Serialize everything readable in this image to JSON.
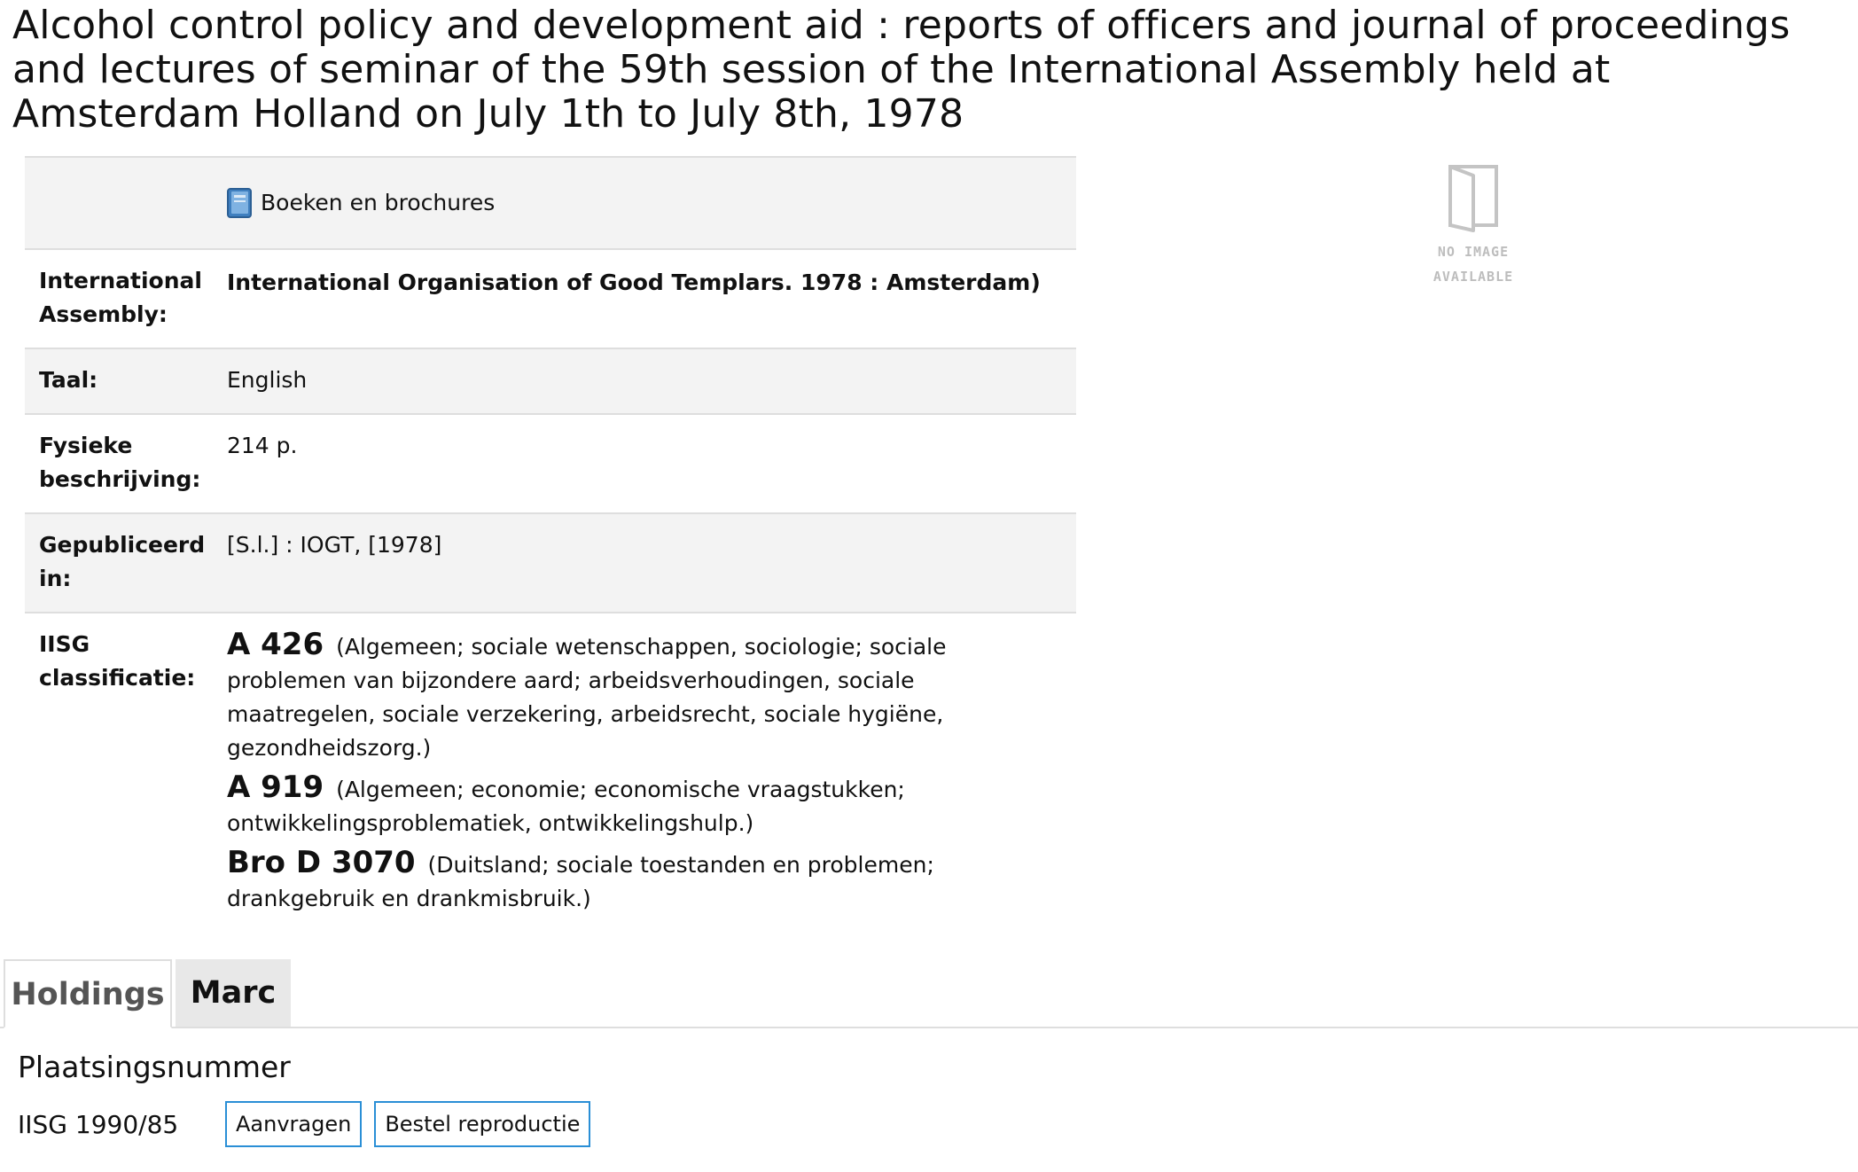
{
  "title": "Alcohol control policy and development aid : reports of officers and journal of proceedings and lectures of seminar of the 59th session of the International Assembly held at Amsterdam Holland on July 1th to July 8th, 1978",
  "format": {
    "icon": "book-icon",
    "label": "Boeken en brochures"
  },
  "record": {
    "assembly": {
      "label": "International Assembly:",
      "value": "International Organisation of Good Templars. 1978 : Amsterdam)"
    },
    "language": {
      "label": "Taal:",
      "value": "English"
    },
    "physical": {
      "label": "Fysieke beschrijving:",
      "value": "214 p."
    },
    "published": {
      "label": "Gepubliceerd in:",
      "value": "[S.l.] : IOGT, [1978]"
    },
    "classification": {
      "label": "IISG classificatie:",
      "entries": [
        {
          "code": "A 426",
          "description": "(Algemeen; sociale wetenschappen, sociologie; sociale problemen van bijzondere aard; arbeidsverhoudingen, sociale maatregelen, sociale verzekering, arbeidsrecht, sociale hygiëne, gezondheidszorg.)"
        },
        {
          "code": "A 919",
          "description": "(Algemeen; economie; economische vraagstukken; ontwikkelingsproblematiek, ontwikkelingshulp.)"
        },
        {
          "code": "Bro D 3070",
          "description": "(Duitsland; sociale toestanden en problemen; drankgebruik en drankmisbruik.)"
        }
      ]
    }
  },
  "no_image": {
    "line1": "NO IMAGE",
    "line2": "AVAILABLE"
  },
  "tabs": [
    {
      "label": "Holdings",
      "active": true
    },
    {
      "label": "Marc",
      "active": false
    }
  ],
  "holdings": {
    "heading": "Plaatsingsnummer",
    "call_number": "IISG 1990/85",
    "request_button": "Aanvragen",
    "reproduction_button": "Bestel reproductie"
  },
  "colors": {
    "button_border": "#2a8fd6",
    "row_shade": "#f3f3f3",
    "divider": "#dedede"
  }
}
